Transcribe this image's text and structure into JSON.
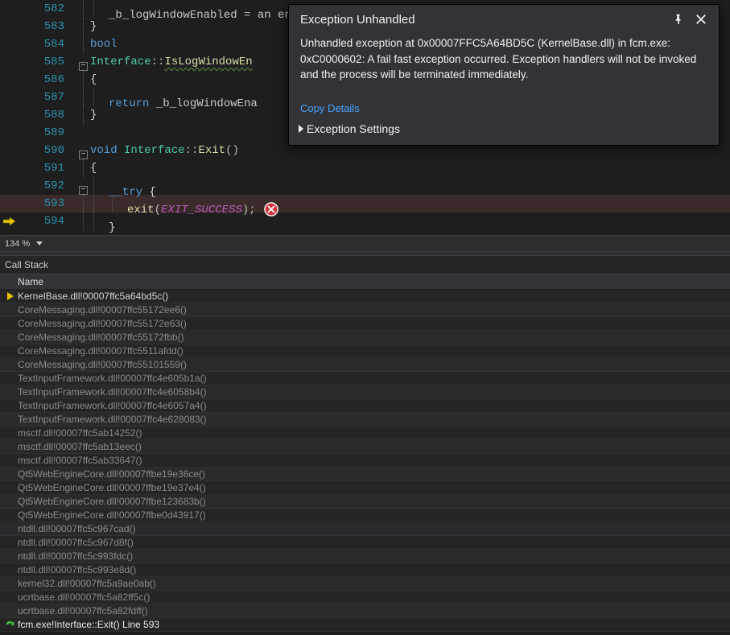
{
  "editor": {
    "lines": [
      {
        "n": "582",
        "outline": "vline",
        "vlines": 1,
        "segs": [
          {
            "c": "ident",
            "t": "_b_logWindowEnabled "
          },
          {
            "c": "op",
            "t": "= "
          },
          {
            "c": "ident",
            "t": "an enabled;"
          }
        ]
      },
      {
        "n": "583",
        "outline": "vline",
        "vlines": 0,
        "segs": [
          {
            "c": "brace",
            "t": "}"
          }
        ]
      },
      {
        "n": "584",
        "outline": "vline",
        "vlines": 0,
        "segs": [
          {
            "c": "kw",
            "t": "bool"
          }
        ]
      },
      {
        "n": "585",
        "outline": "minus",
        "vlines": 0,
        "segs": [
          {
            "c": "cls",
            "t": "Interface"
          },
          {
            "c": "op",
            "t": "::"
          },
          {
            "c": "fn-wavy",
            "t": "IsLogWindowEn"
          }
        ]
      },
      {
        "n": "586",
        "outline": "vline",
        "vlines": 0,
        "segs": [
          {
            "c": "brace",
            "t": "{"
          }
        ]
      },
      {
        "n": "587",
        "outline": "vline",
        "vlines": 1,
        "segs": [
          {
            "c": "kw",
            "t": "return "
          },
          {
            "c": "ident",
            "t": "_b_logWindowEna"
          }
        ]
      },
      {
        "n": "588",
        "outline": "vline",
        "vlines": 0,
        "segs": [
          {
            "c": "brace",
            "t": "}"
          }
        ]
      },
      {
        "n": "589",
        "outline": "none",
        "vlines": 0,
        "segs": []
      },
      {
        "n": "590",
        "outline": "minus",
        "vlines": 0,
        "segs": [
          {
            "c": "kw",
            "t": "void "
          },
          {
            "c": "cls",
            "t": "Interface"
          },
          {
            "c": "op",
            "t": "::"
          },
          {
            "c": "fn",
            "t": "Exit"
          },
          {
            "c": "op",
            "t": "()"
          }
        ]
      },
      {
        "n": "591",
        "outline": "vline",
        "vlines": 0,
        "segs": [
          {
            "c": "brace",
            "t": "{"
          }
        ]
      },
      {
        "n": "592",
        "outline": "minus",
        "vlines": 1,
        "segs": [
          {
            "c": "kw",
            "t": "__try "
          },
          {
            "c": "brace",
            "t": "{"
          }
        ]
      },
      {
        "n": "593",
        "outline": "vline",
        "vlines": 2,
        "exec": true,
        "err": true,
        "segs": [
          {
            "c": "macfn",
            "t": "exit"
          },
          {
            "c": "op",
            "t": "("
          },
          {
            "c": "mac",
            "t": "EXIT_SUCCESS"
          },
          {
            "c": "op",
            "t": ");"
          }
        ]
      },
      {
        "n": "594",
        "outline": "vline",
        "vlines": 1,
        "segs": [
          {
            "c": "brace",
            "t": "}"
          }
        ]
      }
    ]
  },
  "popup": {
    "title": "Exception Unhandled",
    "body": "Unhandled exception at 0x00007FFC5A64BD5C (KernelBase.dll) in fcm.exe: 0xC0000602:  A fail fast exception occurred. Exception handlers will not be invoked and the process will be terminated immediately.",
    "copy": "Copy Details",
    "settings": "Exception Settings"
  },
  "zoom": {
    "value": "134 %"
  },
  "callstack": {
    "title": "Call Stack",
    "header": "Name",
    "frames": [
      {
        "t": "KernelBase.dll!00007ffc5a64bd5c()",
        "mk": "arrow",
        "active": true
      },
      {
        "t": "CoreMessaging.dll!00007ffc55172ee6()"
      },
      {
        "t": "CoreMessaging.dll!00007ffc55172e63()"
      },
      {
        "t": "CoreMessaging.dll!00007ffc55172fbb()"
      },
      {
        "t": "CoreMessaging.dll!00007ffc5511afdd()"
      },
      {
        "t": "CoreMessaging.dll!00007ffc55101559()"
      },
      {
        "t": "TextInputFramework.dll!00007ffc4e605b1a()"
      },
      {
        "t": "TextInputFramework.dll!00007ffc4e6058b4()"
      },
      {
        "t": "TextInputFramework.dll!00007ffc4e6057a4()"
      },
      {
        "t": "TextInputFramework.dll!00007ffc4e628083()"
      },
      {
        "t": "msctf.dll!00007ffc5ab14252()"
      },
      {
        "t": "msctf.dll!00007ffc5ab13eec()"
      },
      {
        "t": "msctf.dll!00007ffc5ab33647()"
      },
      {
        "t": "Qt5WebEngineCore.dll!00007ffbe19e36ce()"
      },
      {
        "t": "Qt5WebEngineCore.dll!00007ffbe19e37e4()"
      },
      {
        "t": "Qt5WebEngineCore.dll!00007ffbe123683b()"
      },
      {
        "t": "Qt5WebEngineCore.dll!00007ffbe0d43917()"
      },
      {
        "t": "ntdll.dll!00007ffc5c967cad()"
      },
      {
        "t": "ntdll.dll!00007ffc5c967d8f()"
      },
      {
        "t": "ntdll.dll!00007ffc5c993fdc()"
      },
      {
        "t": "ntdll.dll!00007ffc5c993e8d()"
      },
      {
        "t": "kernel32.dll!00007ffc5a9ae0ab()"
      },
      {
        "t": "ucrtbase.dll!00007ffc5a82ff5c()"
      },
      {
        "t": "ucrtbase.dll!00007ffc5a82fdff()"
      },
      {
        "t": "fcm.exe!Interface::Exit() Line 593",
        "mk": "green",
        "user": true
      }
    ]
  }
}
